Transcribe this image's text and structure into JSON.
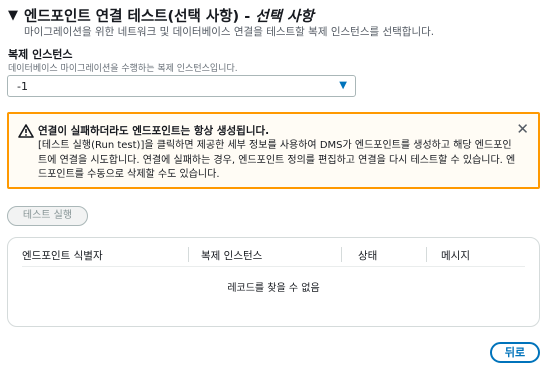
{
  "section": {
    "title": "엔드포인트 연결 테스트(선택 사항)",
    "title_separator": " - ",
    "title_optional": "선택 사항",
    "subtitle": "마이그레이션을 위한 네트워크 및 데이터베이스 연결을 테스트할 복제 인스턴스를 선택합니다."
  },
  "replication_instance": {
    "label": "복제 인스턴스",
    "description": "데이터베이스 마이그레이션을 수행하는 복제 인스턴스입니다.",
    "selected_value": "-1"
  },
  "alert": {
    "type": "warning",
    "heading": "연결이 실패하더라도 엔드포인트는 항상 생성됩니다.",
    "body": "[테스트 실행(Run test)]을 클릭하면 제공한 세부 정보를 사용하여 DMS가 엔드포인트를 생성하고 해당 엔드포인트에 연결을 시도합니다. 연결에 실패하는 경우, 엔드포인트 정의를 편집하고 연결을 다시 테스트할 수 있습니다. 엔드포인트를 수동으로 삭제할 수도 있습니다.",
    "close_icon": "close-icon",
    "color": "#ff9900"
  },
  "run_test_button": {
    "label": "테스트 실행"
  },
  "table": {
    "columns": [
      "엔드포인트 식별자",
      "복제 인스턴스",
      "상태",
      "메시지"
    ],
    "empty_message": "레코드를 찾을 수 없음"
  },
  "back_button": {
    "label": "뒤로"
  },
  "colors": {
    "accent": "#0073bb",
    "warning": "#ff9900",
    "disabled_text": "#879596"
  }
}
